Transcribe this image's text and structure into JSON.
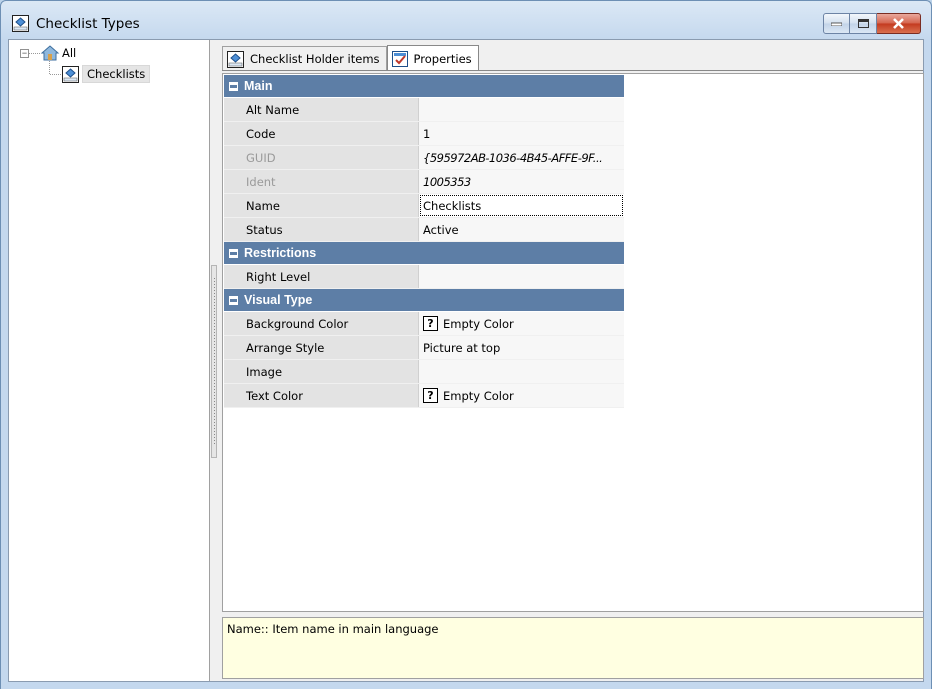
{
  "window": {
    "title": "Checklist Types",
    "buttons": {
      "minimize": "minimize",
      "maximize": "maximize",
      "close": "close"
    }
  },
  "tree": {
    "root": {
      "label": "All",
      "icon": "house-icon",
      "expander": "−"
    },
    "child": {
      "label": "Checklists",
      "icon": "checklist-type-icon",
      "selected": true
    }
  },
  "tabs": [
    {
      "label": "Checklist Holder items",
      "icon": "checklist-type-icon",
      "active": false
    },
    {
      "label": "Properties",
      "icon": "properties-icon",
      "active": true
    }
  ],
  "property_grid": {
    "categories": [
      {
        "name": "Main",
        "rows": [
          {
            "name": "Alt Name",
            "value": ""
          },
          {
            "name": "Code",
            "value": "1"
          },
          {
            "name": "GUID",
            "value": "{595972AB-1036-4B45-AFFE-9F...",
            "disabled": true
          },
          {
            "name": "Ident",
            "value": "1005353",
            "disabled": true
          },
          {
            "name": "Name",
            "value": "Checklists",
            "focused": true
          },
          {
            "name": "Status",
            "value": "Active"
          }
        ]
      },
      {
        "name": "Restrictions",
        "rows": [
          {
            "name": "Right Level",
            "value": ""
          }
        ]
      },
      {
        "name": "Visual Type",
        "rows": [
          {
            "name": "Background Color",
            "value": "Empty Color",
            "swatch": "?"
          },
          {
            "name": "Arrange Style",
            "value": "Picture at top"
          },
          {
            "name": "Image",
            "value": ""
          },
          {
            "name": "Text Color",
            "value": "Empty Color",
            "swatch": "?"
          }
        ]
      }
    ]
  },
  "description": "Name:: Item name in main language",
  "colors": {
    "category_header": "#5d7ea6",
    "description_bg": "#ffffe1",
    "close_button": "#c3391f"
  }
}
